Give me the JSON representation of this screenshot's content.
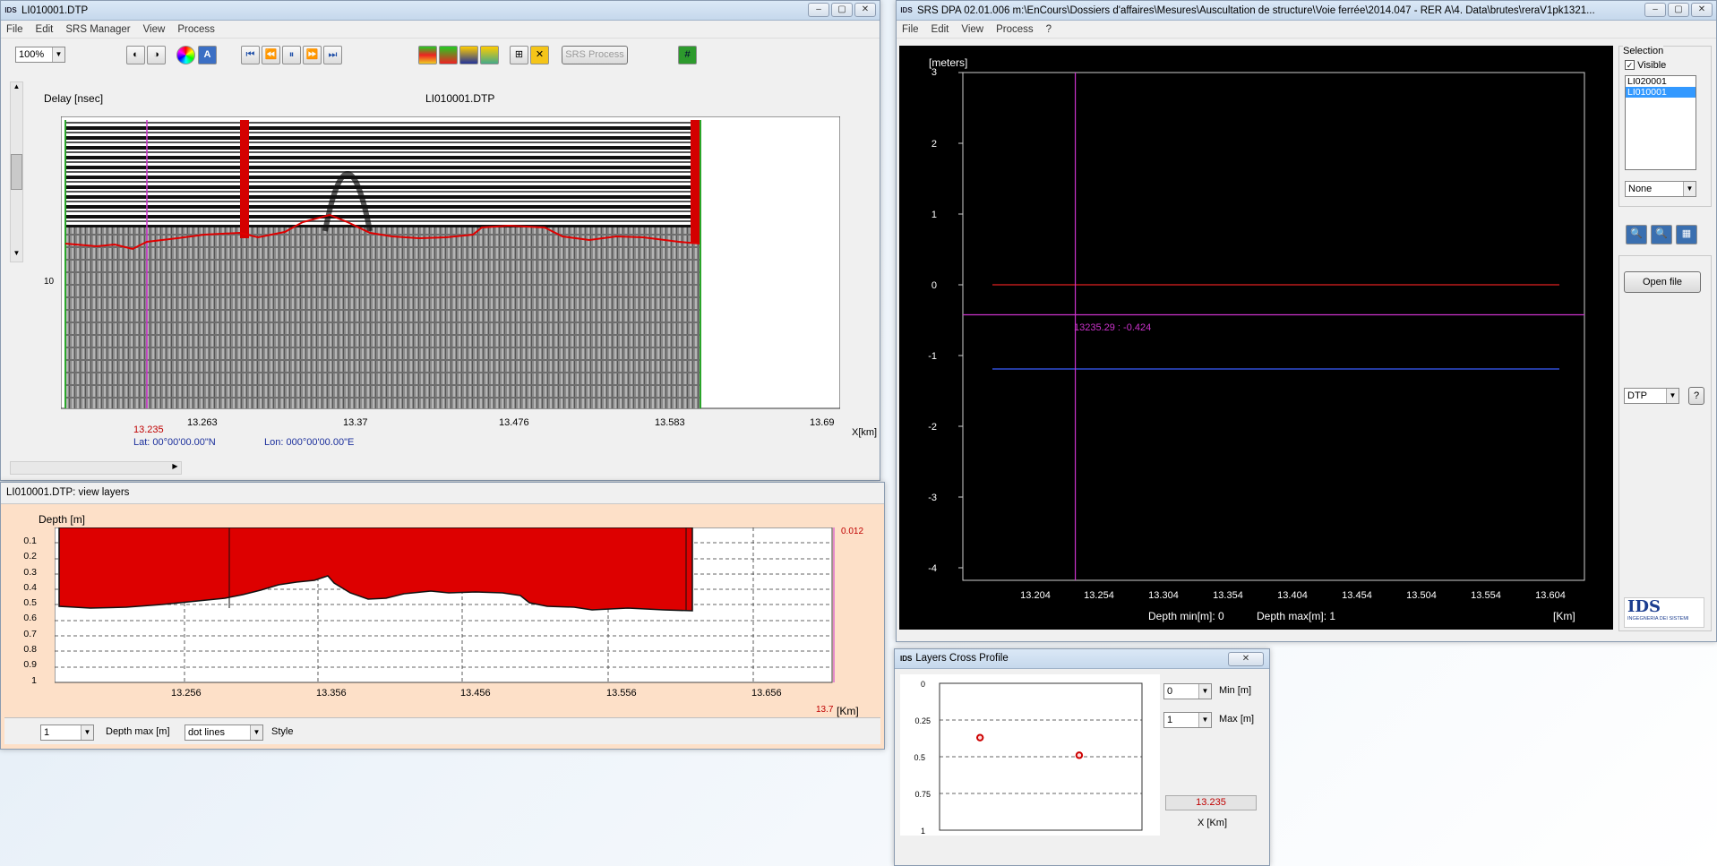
{
  "radar_window": {
    "title": "LI010001.DTP",
    "menu": [
      "File",
      "Edit",
      "SRS Manager",
      "View",
      "Process"
    ],
    "zoom": "100%",
    "srs_process_label": "SRS Process",
    "delay_label": "Delay [nsec]",
    "file_label": "LI010001.DTP",
    "y_tick": "10",
    "x_ticks": [
      "13.263",
      "13.37",
      "13.476",
      "13.583",
      "13.69"
    ],
    "x_unit": "X[km]",
    "cursor_x": "13.235",
    "lat": "Lat: 00°00'00.00\"N",
    "lon": "Lon: 000°00'00.00\"E",
    "legend_top": "0",
    "legend_bottom": "0",
    "colors": {
      "cursor": "#cc33cc",
      "layer": "#e00000",
      "green": "#2aa52a"
    }
  },
  "layers_window": {
    "title": "LI010001.DTP: view layers",
    "depth_label": "Depth [m]",
    "y_ticks": [
      "0.1",
      "0.2",
      "0.3",
      "0.4",
      "0.5",
      "0.6",
      "0.7",
      "0.8",
      "0.9",
      "1"
    ],
    "x_ticks": [
      "13.256",
      "13.356",
      "13.456",
      "13.556",
      "13.656"
    ],
    "right_value": "0.012",
    "x_end": "13.7",
    "x_unit": "[Km]",
    "depth_max_value": "1",
    "depth_max_label": "Depth max [m]",
    "style_value": "dot lines",
    "style_label": "Style",
    "fill_color": "#dd0000",
    "bg_color": "#fde0c8"
  },
  "dpa_window": {
    "title": "SRS DPA  02.01.006 m:\\EnCours\\Dossiers d'affaires\\Mesures\\Auscultation de structure\\Voie ferrée\\2014.047 - RER A\\4. Data\\brutes\\reraV1pk1321...",
    "menu": [
      "File",
      "Edit",
      "View",
      "Process",
      "?"
    ],
    "y_unit": "[meters]",
    "y_ticks": [
      "3",
      "2",
      "1",
      "0",
      "-1",
      "-2",
      "-3",
      "-4"
    ],
    "x_ticks": [
      "13.204",
      "13.254",
      "13.304",
      "13.354",
      "13.404",
      "13.454",
      "13.504",
      "13.554",
      "13.604"
    ],
    "x_unit": "[Km]",
    "cursor_readout": "13235.29  :  -0.424",
    "depth_min": "Depth min[m]: 0",
    "depth_max": "Depth max[m]: 1",
    "selection": {
      "label": "Selection",
      "visible_label": "Visible",
      "items": [
        "LI020001",
        "LI010001"
      ],
      "selected": "LI010001",
      "dropdown": "None"
    },
    "open_file_label": "Open file",
    "format_value": "DTP",
    "help_label": "?",
    "logo_text": "IDS",
    "logo_sub": "INGEGNERIA DEI SISTEMI",
    "lines": {
      "red_y": 0,
      "blue_y": -1.19,
      "cursor_x": 13.235,
      "cursor_y": -0.424
    }
  },
  "cross_window": {
    "title": "Layers Cross Profile",
    "y_ticks": [
      "0",
      "0.25",
      "0.5",
      "0.75",
      "1"
    ],
    "min_value": "0",
    "min_label": "Min [m]",
    "max_value": "1",
    "max_label": "Max [m]",
    "position_value": "13.235",
    "x_unit": "X [Km]",
    "points": [
      {
        "x": 0.2,
        "depth": 0.37
      },
      {
        "x": 0.69,
        "depth": 0.49
      }
    ]
  }
}
